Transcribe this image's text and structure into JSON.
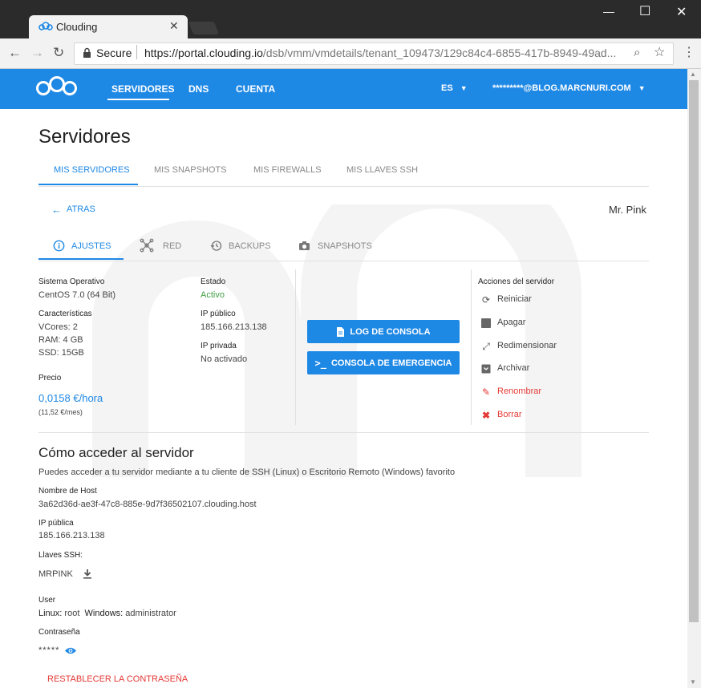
{
  "browser": {
    "tab_title": "Clouding",
    "secure_label": "Secure",
    "url_host": "https://portal.clouding.io",
    "url_path": "/dsb/vmm/vmdetails/tenant_109473/129c84c4-6855-417b-8949-49ad..."
  },
  "header": {
    "nav": [
      "SERVIDORES",
      "DNS",
      "CUENTA"
    ],
    "lang": "ES",
    "user": "*********@BLOG.MARCNURI.COM"
  },
  "page": {
    "title": "Servidores",
    "tabs": [
      "MIS SERVIDORES",
      "MIS SNAPSHOTS",
      "MIS FIREWALLS",
      "MIS LLAVES SSH"
    ],
    "back_label": "ATRAS",
    "server_name": "Mr. Pink",
    "server_tabs": [
      "AJUSTES",
      "RED",
      "BACKUPS",
      "SNAPSHOTS"
    ]
  },
  "info": {
    "os_label": "Sistema Operativo",
    "os_value": "CentOS 7.0 (64 Bit)",
    "features_label": "Características",
    "vcores": "VCores: 2",
    "ram": "RAM: 4 GB",
    "ssd": "SSD: 15GB",
    "price_label": "Precio",
    "price_hour": "0,0158 €/hora",
    "price_month": "(11,52 €/mes)",
    "state_label": "Estado",
    "state_value": "Activo",
    "public_ip_label": "IP público",
    "public_ip_value": "185.166.213.138",
    "private_ip_label": "IP privada",
    "private_ip_value": "No activado"
  },
  "buttons": {
    "console_log": "LOG DE CONSOLA",
    "emergency_console": "CONSOLA DE EMERGENCIA"
  },
  "actions": {
    "title": "Acciones del servidor",
    "items": [
      "Reiniciar",
      "Apagar",
      "Redimensionar",
      "Archivar",
      "Renombrar",
      "Borrar"
    ]
  },
  "access": {
    "title": "Cómo acceder al servidor",
    "description": "Puedes acceder a tu servidor mediante a tu cliente de SSH (Linux) o Escritorio Remoto (Windows) favorito",
    "hostname_label": "Nombre de Host",
    "hostname_value": "3a62d36d-ae3f-47c8-885e-9d7f36502107.clouding.host",
    "public_ip_label": "IP pública",
    "public_ip_value": "185.166.213.138",
    "ssh_keys_label": "Llaves SSH:",
    "ssh_key_name": "MRPINK",
    "user_label": "User",
    "linux_label": "Linux:",
    "linux_user": "root",
    "windows_label": "Windows:",
    "windows_user": "administrator",
    "password_label": "Contraseña",
    "password_masked": "*****",
    "reset_password": "RESTABLECER LA CONTRASEÑA"
  },
  "colors": {
    "primary": "#1e88e5",
    "active_green": "#43a047",
    "danger": "#e53935"
  }
}
